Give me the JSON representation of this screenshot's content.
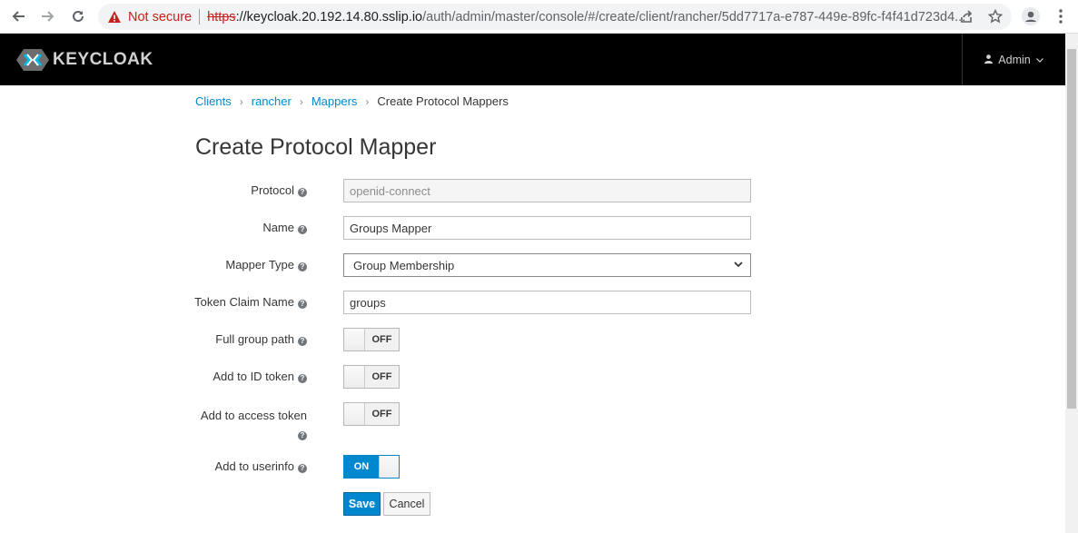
{
  "browser": {
    "security_label": "Not secure",
    "url_scheme": "https",
    "url_rest": "://keycloak.20.192.14.80.sslip.io",
    "url_path": "/auth/admin/master/console/#/create/client/rancher/5dd7717a-e787-449e-89fc-f4f41d723d4..."
  },
  "header": {
    "logo_text": "KEYCLOAK",
    "user_label": "Admin"
  },
  "breadcrumb": [
    {
      "label": "Clients"
    },
    {
      "label": "rancher"
    },
    {
      "label": "Mappers"
    },
    {
      "label": "Create Protocol Mappers"
    }
  ],
  "page": {
    "title": "Create Protocol Mapper"
  },
  "form": {
    "protocol": {
      "label": "Protocol",
      "value": "openid-connect"
    },
    "name": {
      "label": "Name",
      "value": "Groups Mapper"
    },
    "mapper_type": {
      "label": "Mapper Type",
      "value": "Group Membership"
    },
    "token_claim_name": {
      "label": "Token Claim Name",
      "value": "groups"
    },
    "full_group_path": {
      "label": "Full group path",
      "state": "OFF"
    },
    "add_to_id_token": {
      "label": "Add to ID token",
      "state": "OFF"
    },
    "add_to_access_token": {
      "label": "Add to access token",
      "state": "OFF"
    },
    "add_to_userinfo": {
      "label": "Add to userinfo",
      "state": "ON"
    }
  },
  "actions": {
    "save": "Save",
    "cancel": "Cancel"
  },
  "colors": {
    "primary": "#0088ce",
    "header_bg": "#000000",
    "warning": "#c5221f"
  }
}
